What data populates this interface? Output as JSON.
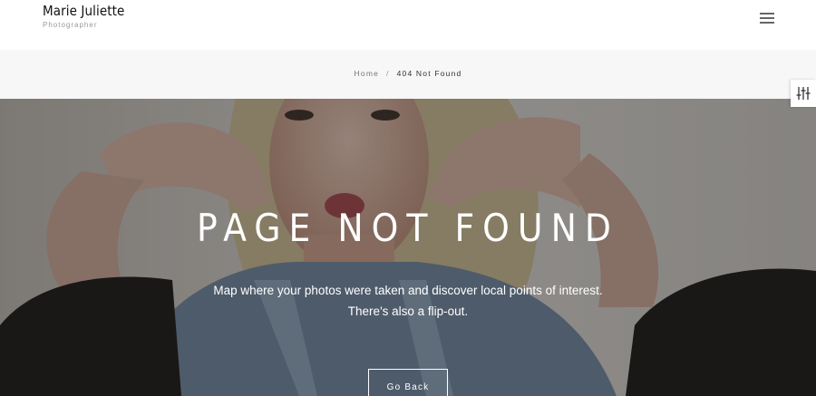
{
  "header": {
    "site_title": "Marie Juliette",
    "site_subtitle": "Photographer",
    "menu_icon": "hamburger-menu-icon"
  },
  "breadcrumb": {
    "home": "Home",
    "separator": "/",
    "current": "404 Not Found"
  },
  "hero": {
    "title": "PAGE NOT FOUND",
    "line1": "Map where your photos were taken and discover local points of interest.",
    "line2": "There's also a flip-out.",
    "button": "Go Back"
  },
  "settings_tab": {
    "icon": "sliders-icon"
  },
  "colors": {
    "overlay": "#000000",
    "breadcrumb_bg": "#f7f7f7",
    "text_light": "#ffffff"
  }
}
